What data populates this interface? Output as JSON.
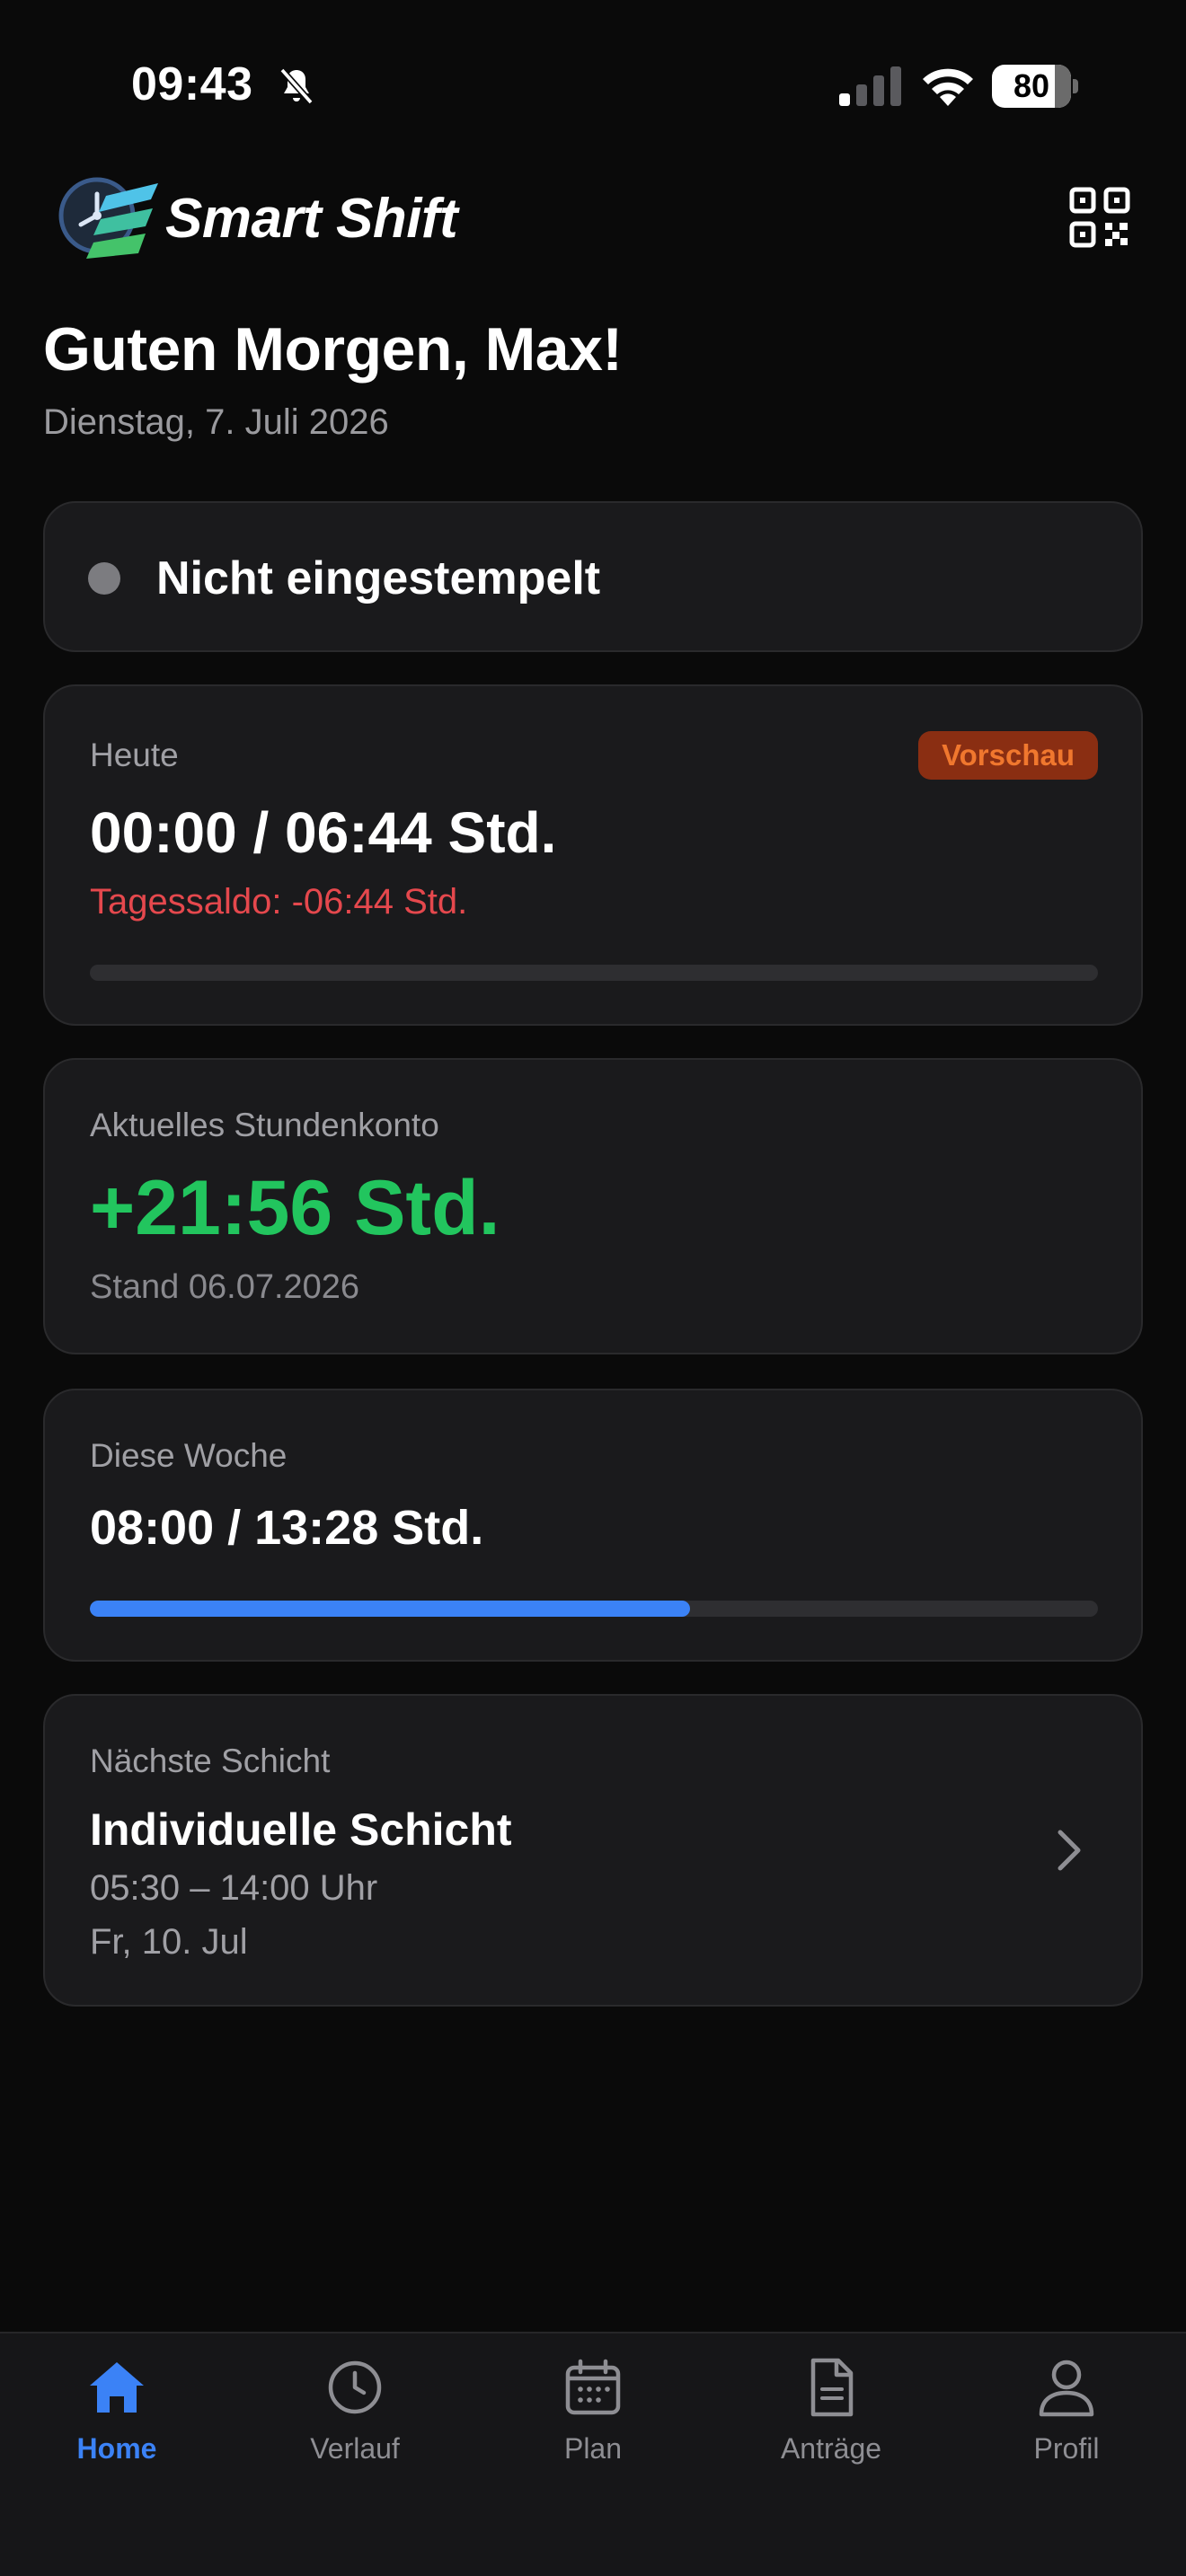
{
  "status_bar": {
    "time": "09:43",
    "battery": "80",
    "icons": [
      "bell-slash-icon",
      "cellular-signal-icon",
      "wifi-icon",
      "battery-icon"
    ]
  },
  "header": {
    "app_name": "Smart Shift",
    "qr_icon": "qr-code-icon"
  },
  "greeting": {
    "title": "Guten Morgen, Max!",
    "date": "Dienstag, 7. Juli 2026"
  },
  "clock_status": {
    "text": "Nicht eingestempelt",
    "dot_color": "#7c7c80"
  },
  "today": {
    "label": "Heute",
    "badge": "Vorschau",
    "value": "00:00 / 06:44 Std.",
    "saldo": "Tagessaldo: -06:44 Std.",
    "progress": 0
  },
  "konto": {
    "label": "Aktuelles Stundenkonto",
    "value": "+21:56 Std.",
    "stand": "Stand 06.07.2026",
    "value_color": "#22c55e"
  },
  "week": {
    "label": "Diese Woche",
    "value": "08:00 / 13:28 Std.",
    "progress": 0.595
  },
  "next_shift": {
    "label": "Nächste Schicht",
    "title": "Individuelle Schicht",
    "time": "05:30 – 14:00 Uhr",
    "date": "Fr, 10. Jul"
  },
  "tabs": [
    {
      "label": "Home",
      "icon": "home-icon",
      "active": true
    },
    {
      "label": "Verlauf",
      "icon": "clock-icon",
      "active": false
    },
    {
      "label": "Plan",
      "icon": "calendar-icon",
      "active": false
    },
    {
      "label": "Anträge",
      "icon": "document-icon",
      "active": false
    },
    {
      "label": "Profil",
      "icon": "person-icon",
      "active": false
    }
  ],
  "colors": {
    "accent": "#3b82f6",
    "positive": "#22c55e",
    "negative": "#e5484d",
    "badge_bg": "#8a2e12",
    "badge_text": "#f0772e"
  }
}
